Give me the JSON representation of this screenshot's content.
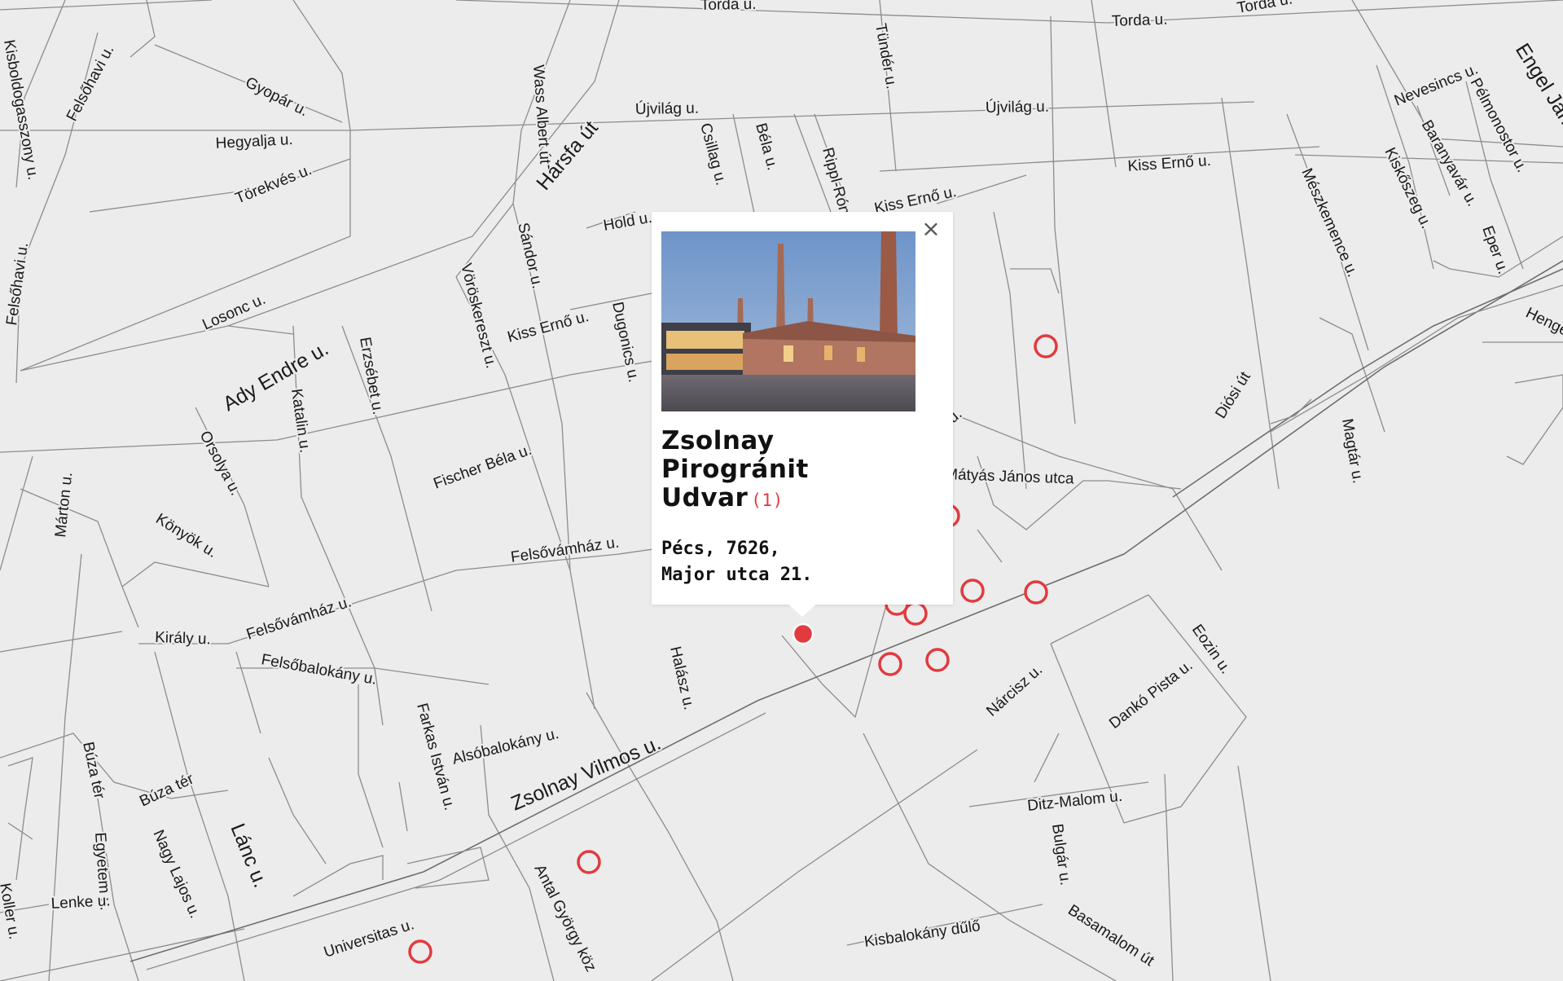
{
  "map": {
    "streets": [
      "Torda u.",
      "Torda u.",
      "Torda u.",
      "Tündér u.",
      "Újvilág u.",
      "Újvilág u.",
      "Kiss Ernő u.",
      "Kiss Ernő u.",
      "Kiss Ernő u.",
      "Hársfa út",
      "Wass Albert út",
      "Felsőhavi u.",
      "Felsőhavi u.",
      "Gyopár u.",
      "Hegyalja u.",
      "Törekvés u.",
      "Losonc u.",
      "Ady Endre u.",
      "Kisboldogasszony u.",
      "Hold u.",
      "Csillag u.",
      "Béla u.",
      "Rippl-Rónai",
      "Sándor u.",
      "Vöröskereszt u.",
      "Dugonics u.",
      "Erzsébet u.",
      "Katalin u.",
      "Orsolya u.",
      "Márton u.",
      "Fischer Béla u.",
      "Könyök u.",
      "Felsővámház u.",
      "Felsővámház u.",
      "Király u.",
      "Felsőbalokány u.",
      "Halász u.",
      "Alsóbalokány u.",
      "Farkas István u.",
      "Zsolnay Vilmos u.",
      "Búza tér",
      "Búza tér",
      "Nagy Lajos u.",
      "Lánc u.",
      "Egyetem u.",
      "Lenke u.",
      "Koller u.",
      "Universitas u.",
      "Antal György köz",
      "Nárcisz u.",
      "Dankó Pista u.",
      "Eozin u.",
      "Ditz-Malom u.",
      "Bulgár u.",
      "Kisbalokány dűlő",
      "Basamalom út",
      "Mátyás János utca",
      "Diósi út",
      "Magtár u.",
      "Mészkemence u.",
      "Kiskőszeg u.",
      "Baranyavár u.",
      "Nevesincs u.",
      "Pélmonostor u.",
      "Eper u.",
      "Engel János",
      "Henger",
      "u."
    ]
  },
  "markers": {
    "count": 11,
    "active_index": 0
  },
  "popup": {
    "title_lines": [
      "Zsolnay",
      "Pirogránit",
      "Udvar"
    ],
    "count": "(1)",
    "address_lines": [
      "Pécs, 7626,",
      "Major utca 21."
    ],
    "close_symbol": "×"
  },
  "colors": {
    "accent": "#e23a3f",
    "map_background": "#ececec",
    "road": "#8c8c8c"
  }
}
